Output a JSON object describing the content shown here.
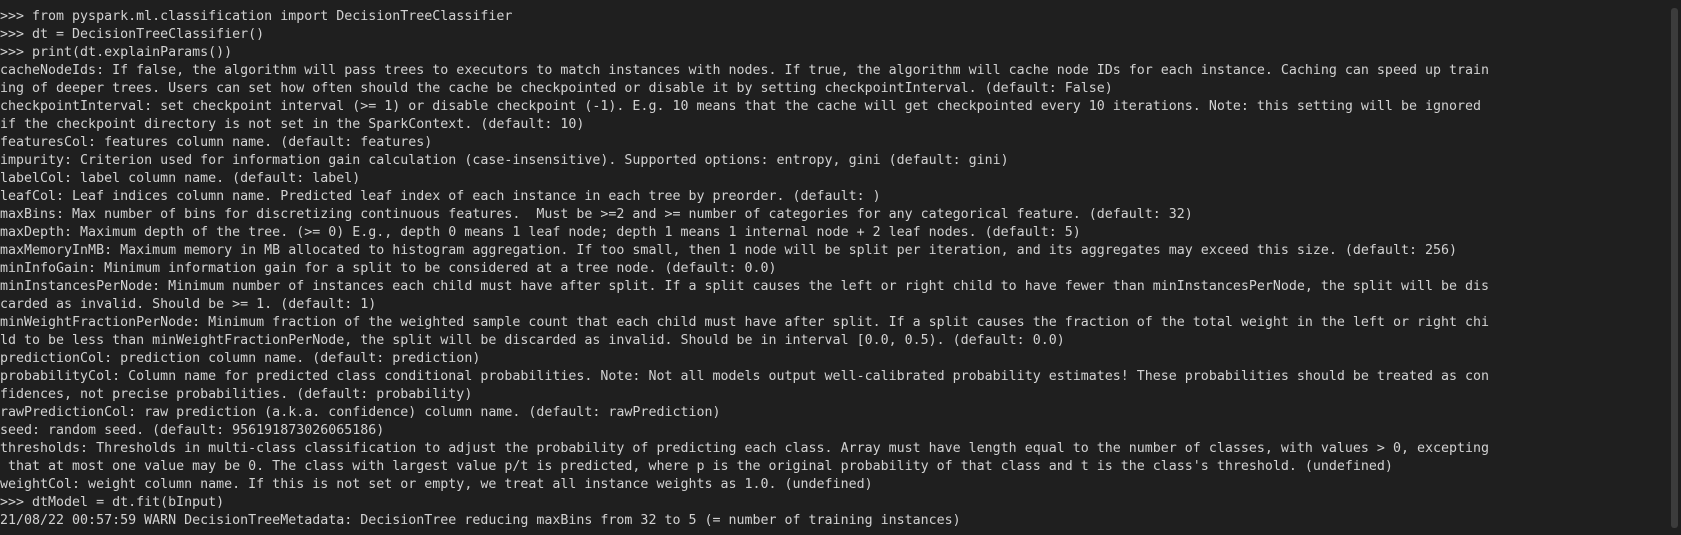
{
  "terminal": {
    "lines": [
      ">>> from pyspark.ml.classification import DecisionTreeClassifier",
      ">>> dt = DecisionTreeClassifier()",
      ">>> print(dt.explainParams())",
      "cacheNodeIds: If false, the algorithm will pass trees to executors to match instances with nodes. If true, the algorithm will cache node IDs for each instance. Caching can speed up train",
      "ing of deeper trees. Users can set how often should the cache be checkpointed or disable it by setting checkpointInterval. (default: False)",
      "checkpointInterval: set checkpoint interval (>= 1) or disable checkpoint (-1). E.g. 10 means that the cache will get checkpointed every 10 iterations. Note: this setting will be ignored",
      "if the checkpoint directory is not set in the SparkContext. (default: 10)",
      "featuresCol: features column name. (default: features)",
      "impurity: Criterion used for information gain calculation (case-insensitive). Supported options: entropy, gini (default: gini)",
      "labelCol: label column name. (default: label)",
      "leafCol: Leaf indices column name. Predicted leaf index of each instance in each tree by preorder. (default: )",
      "maxBins: Max number of bins for discretizing continuous features.  Must be >=2 and >= number of categories for any categorical feature. (default: 32)",
      "maxDepth: Maximum depth of the tree. (>= 0) E.g., depth 0 means 1 leaf node; depth 1 means 1 internal node + 2 leaf nodes. (default: 5)",
      "maxMemoryInMB: Maximum memory in MB allocated to histogram aggregation. If too small, then 1 node will be split per iteration, and its aggregates may exceed this size. (default: 256)",
      "minInfoGain: Minimum information gain for a split to be considered at a tree node. (default: 0.0)",
      "minInstancesPerNode: Minimum number of instances each child must have after split. If a split causes the left or right child to have fewer than minInstancesPerNode, the split will be dis",
      "carded as invalid. Should be >= 1. (default: 1)",
      "minWeightFractionPerNode: Minimum fraction of the weighted sample count that each child must have after split. If a split causes the fraction of the total weight in the left or right chi",
      "ld to be less than minWeightFractionPerNode, the split will be discarded as invalid. Should be in interval [0.0, 0.5). (default: 0.0)",
      "predictionCol: prediction column name. (default: prediction)",
      "probabilityCol: Column name for predicted class conditional probabilities. Note: Not all models output well-calibrated probability estimates! These probabilities should be treated as con",
      "fidences, not precise probabilities. (default: probability)",
      "rawPredictionCol: raw prediction (a.k.a. confidence) column name. (default: rawPrediction)",
      "seed: random seed. (default: 956191873026065186)",
      "thresholds: Thresholds in multi-class classification to adjust the probability of predicting each class. Array must have length equal to the number of classes, with values > 0, excepting",
      " that at most one value may be 0. The class with largest value p/t is predicted, where p is the original probability of that class and t is the class's threshold. (undefined)",
      "weightCol: weight column name. If this is not set or empty, we treat all instance weights as 1.0. (undefined)",
      ">>> dtModel = dt.fit(bInput)",
      "21/08/22 00:57:59 WARN DecisionTreeMetadata: DecisionTree reducing maxBins from 32 to 5 (= number of training instances)"
    ]
  },
  "colors": {
    "background": "#1f1f1f",
    "foreground": "#d2d2d2"
  }
}
